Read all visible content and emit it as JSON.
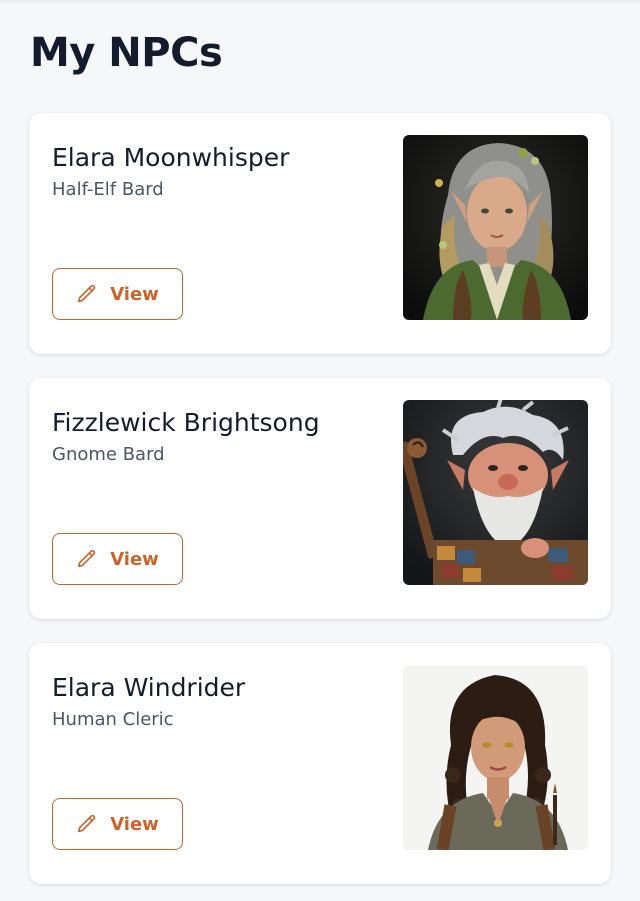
{
  "page": {
    "title": "My NPCs"
  },
  "npcs": [
    {
      "name": "Elara Moonwhisper",
      "subtitle": "Half-Elf Bard",
      "view_label": "View",
      "portrait_alt": "Elara Moonwhisper portrait"
    },
    {
      "name": "Fizzlewick Brightsong",
      "subtitle": "Gnome Bard",
      "view_label": "View",
      "portrait_alt": "Fizzlewick Brightsong portrait"
    },
    {
      "name": "Elara Windrider",
      "subtitle": "Human Cleric",
      "view_label": "View",
      "portrait_alt": "Elara Windrider portrait"
    }
  ],
  "icons": {
    "view_button": "pencil-icon"
  },
  "colors": {
    "accent": "#c9642a",
    "title": "#141b2d",
    "subtitle": "#4d5566",
    "background": "#f6f7f9",
    "card": "#ffffff"
  }
}
